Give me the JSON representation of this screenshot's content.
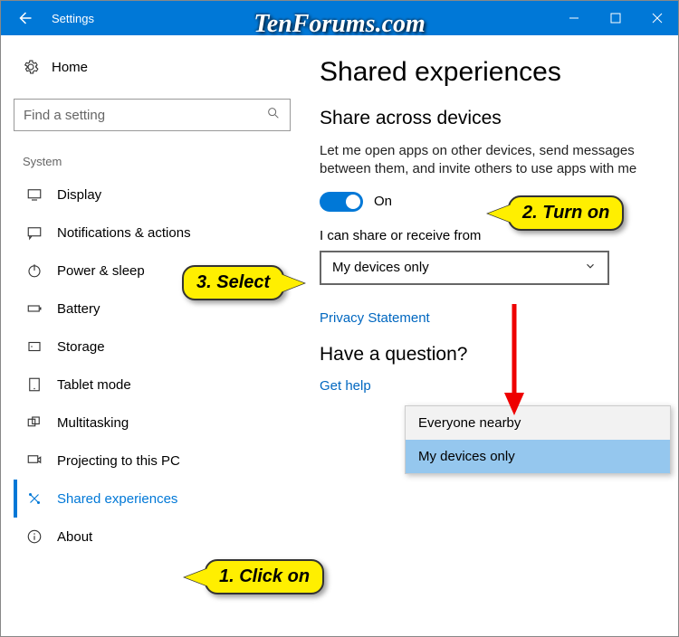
{
  "window": {
    "title": "Settings"
  },
  "watermark": "TenForums.com",
  "sidebar": {
    "home": "Home",
    "search_placeholder": "Find a setting",
    "group": "System",
    "items": [
      {
        "label": "Display"
      },
      {
        "label": "Notifications & actions"
      },
      {
        "label": "Power & sleep"
      },
      {
        "label": "Battery"
      },
      {
        "label": "Storage"
      },
      {
        "label": "Tablet mode"
      },
      {
        "label": "Multitasking"
      },
      {
        "label": "Projecting to this PC"
      },
      {
        "label": "Shared experiences"
      },
      {
        "label": "About"
      }
    ]
  },
  "main": {
    "heading": "Shared experiences",
    "section1_title": "Share across devices",
    "section1_desc": "Let me open apps on other devices, send messages between them, and invite others to use apps with me",
    "toggle_state": "On",
    "share_label": "I can share or receive from",
    "dropdown_value": "My devices only",
    "privacy_link": "Privacy Statement",
    "question_title": "Have a question?",
    "help_link": "Get help"
  },
  "dropdown_options": [
    {
      "label": "Everyone nearby",
      "selected": false
    },
    {
      "label": "My devices only",
      "selected": true
    }
  ],
  "callouts": {
    "c1": "1. Click on",
    "c2": "2. Turn on",
    "c3": "3. Select"
  }
}
